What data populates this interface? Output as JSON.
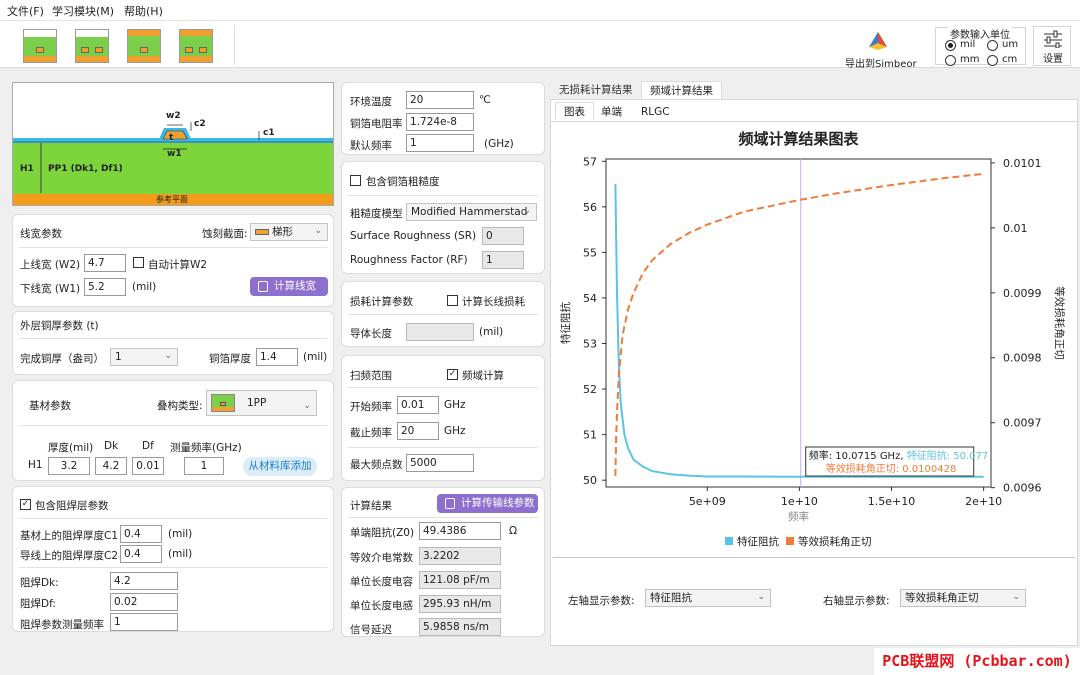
{
  "menu": {
    "file": "文件(F)",
    "learning": "学习模块(M)",
    "help": "帮助(H)"
  },
  "toolbar": {
    "export_label": "导出到Simbeor",
    "settings_label": "设置"
  },
  "unit_group": {
    "title": "参数输入单位",
    "options": [
      "mil",
      "um",
      "mm",
      "cm"
    ],
    "selected": "mil"
  },
  "diagram": {
    "w2": "w2",
    "c2": "c2",
    "t": "t",
    "c1": "c1",
    "w1": "w1",
    "h1": "H1",
    "pp1": "PP1 (Dk1, Df1)",
    "ref": "参考平面"
  },
  "line_width": {
    "title": "线宽参数",
    "etch_label": "蚀刻截面:",
    "etch_value": "梯形",
    "w2_label": "上线宽 (W2)",
    "w2_value": "4.7",
    "auto_label": "自动计算W2",
    "w1_label": "下线宽 (W1)",
    "w1_value": "5.2",
    "unit": "(mil)",
    "calc_button": "计算线宽"
  },
  "copper": {
    "title": "外层铜厚参数 (t)",
    "finish_label": "完成铜厚（盎司）",
    "finish_value": "1",
    "foil_label": "铜箔厚度",
    "foil_value": "1.4",
    "unit": "(mil)"
  },
  "substrate": {
    "title": "基材参数",
    "stack_label": "叠构类型:",
    "stack_value": "1PP",
    "headers": [
      "厚度(mil)",
      "Dk",
      "Df",
      "测量频率(GHz)"
    ],
    "row_label": "H1",
    "thickness": "3.2",
    "dk": "4.2",
    "df": "0.01",
    "freq": "1",
    "add_button": "从材料库添加"
  },
  "solder_mask": {
    "checkbox_label": "包含阻焊层参数",
    "checked": true,
    "c1_label": "基材上的阻焊厚度C1",
    "c1_value": "0.4",
    "c2_label": "导线上的阻焊厚度C2",
    "c2_value": "0.4",
    "unit": "(mil)",
    "dk_label": "阻焊Dk:",
    "dk_value": "4.2",
    "df_label": "阻焊Df:",
    "df_value": "0.02",
    "freq_label": "阻焊参数测量频率",
    "freq_value": "1"
  },
  "environment": {
    "temp_label": "环境温度",
    "temp_value": "20",
    "temp_unit": "℃",
    "res_label": "铜箔电阻率",
    "res_value": "1.724e-8",
    "freq_label": "默认频率",
    "freq_value": "1",
    "freq_unit": "(GHz)"
  },
  "roughness": {
    "checkbox_label": "包含铜箔粗糙度",
    "checked": false,
    "model_label": "粗糙度模型",
    "model_value": "Modified Hammerstad",
    "sr_label": "Surface Roughness (SR)",
    "sr_value": "0",
    "rf_label": "Roughness Factor (RF)",
    "rf_value": "1"
  },
  "loss": {
    "title": "损耗计算参数",
    "checkbox_label": "计算长线损耗",
    "checked": false,
    "length_label": "导体长度",
    "length_unit": "(mil)"
  },
  "sweep": {
    "title": "扫频范围",
    "checkbox_label": "频域计算",
    "checked": true,
    "start_label": "开始频率",
    "start_value": "0.01",
    "start_unit": "GHz",
    "stop_label": "截止频率",
    "stop_value": "20",
    "stop_unit": "GHz",
    "points_label": "最大频点数",
    "points_value": "5000"
  },
  "results": {
    "title": "计算结果",
    "calc_button": "计算传输线参数",
    "z0_label": "单端阻抗(Z0)",
    "z0_value": "49.4386",
    "z0_unit": "Ω",
    "er_label": "等效介电常数",
    "er_value": "3.2202",
    "c_label": "单位长度电容",
    "c_value": "121.08 pF/m",
    "l_label": "单位长度电感",
    "l_value": "295.93 nH/m",
    "delay_label": "信号延迟",
    "delay_value": "5.9858 ns/m"
  },
  "right_tabs": {
    "lossless": "无损耗计算结果",
    "freq": "频域计算结果"
  },
  "sub_tabs": {
    "chart": "图表",
    "port": "单端",
    "rlgc": "RLGC"
  },
  "chart_data": {
    "type": "line",
    "title": "频域计算结果图表",
    "xlabel": "频率",
    "ylabel_left": "特征阻抗",
    "ylabel_right": "等效损耗角正切",
    "x_ticks": [
      "5e+09",
      "1e+10",
      "1.5e+10",
      "2e+10"
    ],
    "x_tick_values": [
      5000000000.0,
      10000000000.0,
      15000000000.0,
      20000000000.0
    ],
    "y_left_ticks": [
      "50",
      "51",
      "52",
      "53",
      "54",
      "55",
      "56",
      "57"
    ],
    "y_right_ticks": [
      "0.0096",
      "0.0097",
      "0.0098",
      "0.0099",
      "0.01",
      "0.0101"
    ],
    "xlim": [
      -500000000.0,
      20400000000.0
    ],
    "ylim_left": [
      49.85,
      57.05
    ],
    "ylim_right": [
      0.009601,
      0.010106
    ],
    "series": [
      {
        "name": "特征阻抗",
        "axis": "left",
        "color": "#5bc4e5",
        "style": "solid",
        "x": [
          10000000.0,
          50000000.0,
          100000000.0,
          200000000.0,
          300000000.0,
          500000000.0,
          700000000.0,
          1000000000.0,
          1500000000.0,
          2000000000.0,
          3000000000.0,
          4000000000.0,
          5000000000.0,
          7000000000.0,
          10000000000.0,
          15000000000.0,
          20000000000.0
        ],
        "y": [
          56.5,
          55.4,
          54.0,
          52.5,
          51.7,
          51.0,
          50.7,
          50.45,
          50.3,
          50.2,
          50.13,
          50.1,
          50.08,
          50.08,
          50.077,
          50.075,
          50.073
        ]
      },
      {
        "name": "等效损耗角正切",
        "axis": "right",
        "color": "#f07b3a",
        "style": "dashed",
        "x": [
          10000000.0,
          50000000.0,
          100000000.0,
          200000000.0,
          400000000.0,
          700000000.0,
          1000000000.0,
          1500000000.0,
          2000000000.0,
          3000000000.0,
          4000000000.0,
          5000000000.0,
          7000000000.0,
          10000000000.0,
          12000000000.0,
          15000000000.0,
          18000000000.0,
          20000000000.0
        ],
        "y": [
          0.009618,
          0.009675,
          0.00972,
          0.009775,
          0.009835,
          0.009875,
          0.0099,
          0.00993,
          0.00995,
          0.009975,
          0.009992,
          0.010005,
          0.010025,
          0.0100428,
          0.010053,
          0.010066,
          0.010077,
          0.010083
        ]
      }
    ],
    "cursor": {
      "x": 10071500000.0,
      "freq_text": "频率: 10.0715 GHz,",
      "z_text": "特征阻抗: 50.077",
      "tan_text": "等效损耗角正切: 0.0100428"
    },
    "legend": "bottom"
  },
  "axis_selectors": {
    "left_label": "左轴显示参数:",
    "left_value": "特征阻抗",
    "right_label": "右轴显示参数:",
    "right_value": "等效损耗角正切"
  },
  "watermark": "PCB联盟网 (Pcbbar.com)"
}
